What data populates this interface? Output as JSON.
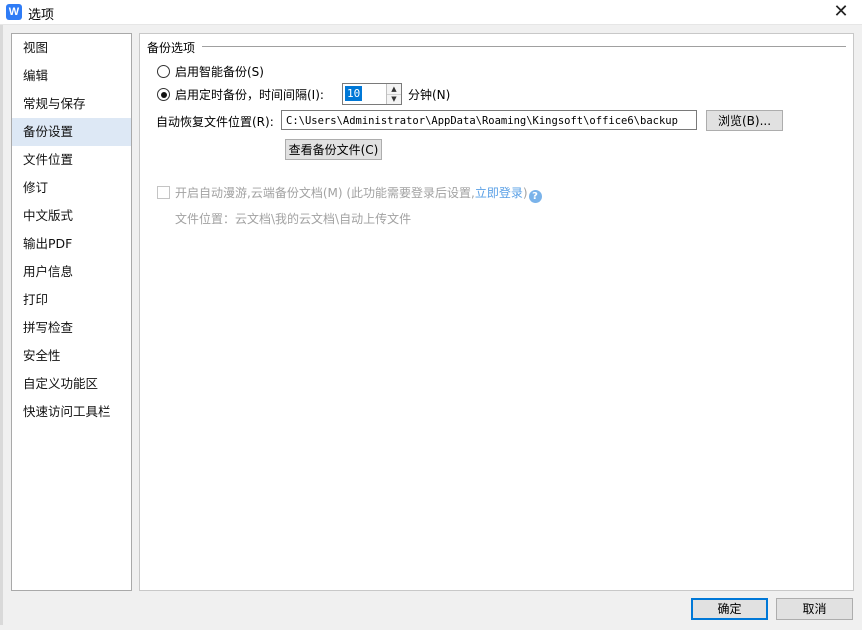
{
  "window": {
    "title": "选项",
    "app_icon_glyph": "W",
    "close_glyph": "✕"
  },
  "sidebar": {
    "items": [
      {
        "label": "视图"
      },
      {
        "label": "编辑"
      },
      {
        "label": "常规与保存"
      },
      {
        "label": "备份设置",
        "active": true
      },
      {
        "label": "文件位置"
      },
      {
        "label": "修订"
      },
      {
        "label": "中文版式"
      },
      {
        "label": "输出PDF"
      },
      {
        "label": "用户信息"
      },
      {
        "label": "打印"
      },
      {
        "label": "拼写检查"
      },
      {
        "label": "安全性"
      },
      {
        "label": "自定义功能区"
      },
      {
        "label": "快速访问工具栏"
      }
    ]
  },
  "backup": {
    "group_title": "备份选项",
    "smart_backup_label": "启用智能备份(S)",
    "timed_backup_label": "启用定时备份，时间间隔(I):",
    "interval_value": "10",
    "interval_unit": "分钟(N)",
    "recovery_location_label": "自动恢复文件位置(R):",
    "recovery_path": "C:\\Users\\Administrator\\AppData\\Roaming\\Kingsoft\\office6\\backup",
    "browse_button": "浏览(B)...",
    "view_backup_button": "查看备份文件(C)",
    "cloud_roaming_label": "开启自动漫游,云端备份文档(M) (此功能需要登录后设置,",
    "login_link": "立即登录",
    "cloud_roaming_suffix": ")",
    "help_glyph": "?",
    "cloud_location_label": "文件位置：云文档\\我的云文档\\自动上传文件"
  },
  "footer": {
    "ok_button": "确定",
    "cancel_button": "取消"
  },
  "colors": {
    "accent": "#0078d7",
    "active_item": "#dde8f5",
    "link": "#5aa0e6"
  }
}
